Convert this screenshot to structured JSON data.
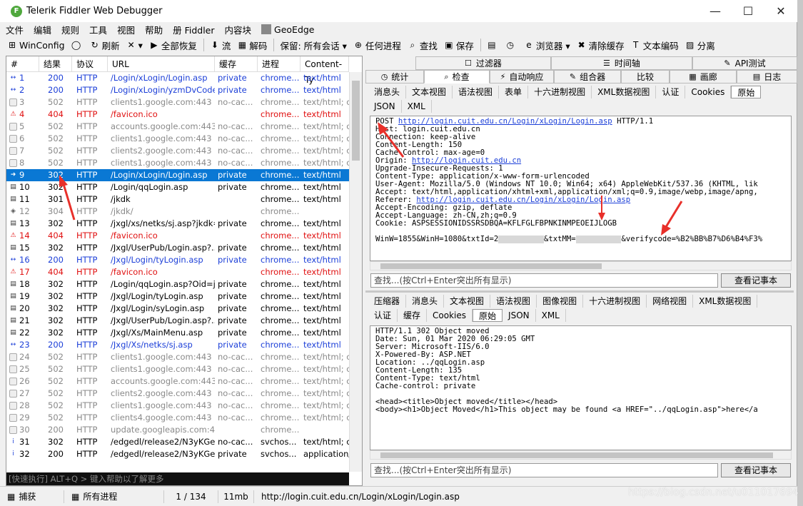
{
  "window": {
    "title": "Telerik Fiddler Web Debugger",
    "app_icon": "F"
  },
  "menu": [
    "文件",
    "编辑",
    "规则",
    "工具",
    "视图",
    "帮助",
    "册 Fiddler",
    "内容块",
    "GeoEdge"
  ],
  "toolbar": [
    {
      "icon": "windows-icon",
      "glyph": "⊞",
      "label": "WinConfig"
    },
    {
      "icon": "comment-icon",
      "glyph": "◯",
      "label": ""
    },
    {
      "icon": "refresh-icon",
      "glyph": "↻",
      "label": "刷新"
    },
    {
      "icon": "remove-icon",
      "glyph": "✕",
      "label": "▾"
    },
    {
      "icon": "play-icon",
      "glyph": "▶",
      "label": "全部恢复"
    },
    {
      "icon": "stream-icon",
      "glyph": "⬇",
      "label": "流"
    },
    {
      "icon": "decode-icon",
      "glyph": "▦",
      "label": "解码"
    },
    {
      "icon": "keep-icon",
      "glyph": "",
      "label": "保留: 所有会话 ▾"
    },
    {
      "icon": "target-icon",
      "glyph": "⊕",
      "label": "任何进程"
    },
    {
      "icon": "find-icon",
      "glyph": "⌕",
      "label": "查找"
    },
    {
      "icon": "save-icon",
      "glyph": "▣",
      "label": "保存"
    },
    {
      "icon": "screenshot-icon",
      "glyph": "▤",
      "label": ""
    },
    {
      "icon": "timer-icon",
      "glyph": "◷",
      "label": ""
    },
    {
      "icon": "browser-icon",
      "glyph": "e",
      "label": "浏览器 ▾"
    },
    {
      "icon": "clear-cache-icon",
      "glyph": "✖",
      "label": "清除缓存"
    },
    {
      "icon": "text-encode-icon",
      "glyph": "T",
      "label": "文本编码"
    },
    {
      "icon": "tearoff-icon",
      "glyph": "▨",
      "label": "分离"
    }
  ],
  "sessions": {
    "columns": [
      "#",
      "结果",
      "协议",
      "URL",
      "缓存",
      "进程",
      "Content-Ty"
    ],
    "rows": [
      {
        "id": "1",
        "result": "200",
        "protocol": "HTTP",
        "url": "/Login/xLogin/Login.asp",
        "cache": "private",
        "process": "chrome...",
        "ctype": "text/html",
        "style": "blue",
        "icon": "↔"
      },
      {
        "id": "2",
        "result": "200",
        "protocol": "HTTP",
        "url": "/Login/xLogin/yzmDvCode...",
        "cache": "private",
        "process": "chrome...",
        "ctype": "text/html",
        "style": "blue",
        "icon": "↔"
      },
      {
        "id": "3",
        "result": "502",
        "protocol": "HTTP",
        "url": "clients1.google.com:443",
        "cache": "no-cac...",
        "process": "chrome...",
        "ctype": "text/html; c",
        "style": "gray",
        "icon": "🔒"
      },
      {
        "id": "4",
        "result": "404",
        "protocol": "HTTP",
        "url": "/favicon.ico",
        "cache": "",
        "process": "chrome...",
        "ctype": "text/html",
        "style": "red",
        "icon": "⚠"
      },
      {
        "id": "5",
        "result": "502",
        "protocol": "HTTP",
        "url": "accounts.google.com:443",
        "cache": "no-cac...",
        "process": "chrome...",
        "ctype": "text/html; c",
        "style": "gray",
        "icon": "🔒"
      },
      {
        "id": "6",
        "result": "502",
        "protocol": "HTTP",
        "url": "clients1.google.com:443",
        "cache": "no-cac...",
        "process": "chrome...",
        "ctype": "text/html; c",
        "style": "gray",
        "icon": "🔒"
      },
      {
        "id": "7",
        "result": "502",
        "protocol": "HTTP",
        "url": "clients2.google.com:443",
        "cache": "no-cac...",
        "process": "chrome...",
        "ctype": "text/html; c",
        "style": "gray",
        "icon": "🔒"
      },
      {
        "id": "8",
        "result": "502",
        "protocol": "HTTP",
        "url": "clients1.google.com:443",
        "cache": "no-cac...",
        "process": "chrome...",
        "ctype": "text/html; c",
        "style": "gray",
        "icon": "🔒"
      },
      {
        "id": "9",
        "result": "302",
        "protocol": "HTTP",
        "url": "/Login/xLogin/Login.asp",
        "cache": "private",
        "process": "chrome...",
        "ctype": "text/html",
        "style": "sel",
        "icon": "➜"
      },
      {
        "id": "10",
        "result": "302",
        "protocol": "HTTP",
        "url": "/Login/qqLogin.asp",
        "cache": "private",
        "process": "chrome...",
        "ctype": "text/html",
        "style": "",
        "icon": "▤"
      },
      {
        "id": "11",
        "result": "301",
        "protocol": "HTTP",
        "url": "/jkdk",
        "cache": "",
        "process": "chrome...",
        "ctype": "text/html",
        "style": "",
        "icon": "▤"
      },
      {
        "id": "12",
        "result": "304",
        "protocol": "HTTP",
        "url": "/jkdk/",
        "cache": "",
        "process": "chrome...",
        "ctype": "",
        "style": "gray",
        "icon": "◈"
      },
      {
        "id": "13",
        "result": "302",
        "protocol": "HTTP",
        "url": "/jxgl/xs/netks/sj.asp?jkdk=Y",
        "cache": "private",
        "process": "chrome...",
        "ctype": "text/html",
        "style": "",
        "icon": "▤"
      },
      {
        "id": "14",
        "result": "404",
        "protocol": "HTTP",
        "url": "/favicon.ico",
        "cache": "",
        "process": "chrome...",
        "ctype": "text/html",
        "style": "red",
        "icon": "⚠"
      },
      {
        "id": "15",
        "result": "302",
        "protocol": "HTTP",
        "url": "/Jxgl/UserPub/Login.asp?...",
        "cache": "private",
        "process": "chrome...",
        "ctype": "text/html",
        "style": "",
        "icon": "▤"
      },
      {
        "id": "16",
        "result": "200",
        "protocol": "HTTP",
        "url": "/Jxgl/Login/tyLogin.asp",
        "cache": "private",
        "process": "chrome...",
        "ctype": "text/html",
        "style": "blue",
        "icon": "↔"
      },
      {
        "id": "17",
        "result": "404",
        "protocol": "HTTP",
        "url": "/favicon.ico",
        "cache": "",
        "process": "chrome...",
        "ctype": "text/html",
        "style": "red",
        "icon": "⚠"
      },
      {
        "id": "18",
        "result": "302",
        "protocol": "HTTP",
        "url": "/Login/qqLogin.asp?Oid=j...",
        "cache": "private",
        "process": "chrome...",
        "ctype": "text/html",
        "style": "",
        "icon": "▤"
      },
      {
        "id": "19",
        "result": "302",
        "protocol": "HTTP",
        "url": "/Jxgl/Login/tyLogin.asp",
        "cache": "private",
        "process": "chrome...",
        "ctype": "text/html",
        "style": "",
        "icon": "▤"
      },
      {
        "id": "20",
        "result": "302",
        "protocol": "HTTP",
        "url": "/Jxgl/Login/syLogin.asp",
        "cache": "private",
        "process": "chrome...",
        "ctype": "text/html",
        "style": "",
        "icon": "▤"
      },
      {
        "id": "21",
        "result": "302",
        "protocol": "HTTP",
        "url": "/Jxgl/UserPub/Login.asp?...",
        "cache": "private",
        "process": "chrome...",
        "ctype": "text/html",
        "style": "",
        "icon": "▤"
      },
      {
        "id": "22",
        "result": "302",
        "protocol": "HTTP",
        "url": "/Jxgl/Xs/MainMenu.asp",
        "cache": "private",
        "process": "chrome...",
        "ctype": "text/html",
        "style": "",
        "icon": "▤"
      },
      {
        "id": "23",
        "result": "200",
        "protocol": "HTTP",
        "url": "/Jxgl/Xs/netks/sj.asp",
        "cache": "private",
        "process": "chrome...",
        "ctype": "text/html",
        "style": "blue",
        "icon": "↔"
      },
      {
        "id": "24",
        "result": "502",
        "protocol": "HTTP",
        "url": "clients1.google.com:443",
        "cache": "no-cac...",
        "process": "chrome...",
        "ctype": "text/html; c",
        "style": "gray",
        "icon": "🔒"
      },
      {
        "id": "25",
        "result": "502",
        "protocol": "HTTP",
        "url": "clients1.google.com:443",
        "cache": "no-cac...",
        "process": "chrome...",
        "ctype": "text/html; c",
        "style": "gray",
        "icon": "🔒"
      },
      {
        "id": "26",
        "result": "502",
        "protocol": "HTTP",
        "url": "accounts.google.com:443",
        "cache": "no-cac...",
        "process": "chrome...",
        "ctype": "text/html; c",
        "style": "gray",
        "icon": "🔒"
      },
      {
        "id": "27",
        "result": "502",
        "protocol": "HTTP",
        "url": "clients2.google.com:443",
        "cache": "no-cac...",
        "process": "chrome...",
        "ctype": "text/html; c",
        "style": "gray",
        "icon": "🔒"
      },
      {
        "id": "28",
        "result": "502",
        "protocol": "HTTP",
        "url": "clients1.google.com:443",
        "cache": "no-cac...",
        "process": "chrome...",
        "ctype": "text/html; c",
        "style": "gray",
        "icon": "🔒"
      },
      {
        "id": "29",
        "result": "502",
        "protocol": "HTTP",
        "url": "clients4.google.com:443",
        "cache": "no-cac...",
        "process": "chrome...",
        "ctype": "text/html; c",
        "style": "gray",
        "icon": "🔒"
      },
      {
        "id": "30",
        "result": "200",
        "protocol": "HTTP",
        "url": "update.googleapis.com:443",
        "cache": "",
        "process": "chrome...",
        "ctype": "",
        "style": "gray",
        "icon": "🔒"
      },
      {
        "id": "31",
        "result": "302",
        "protocol": "HTTP",
        "url": "/edgedl/release2/N3yKGe...",
        "cache": "no-cac...",
        "process": "svchos...",
        "ctype": "text/html; c",
        "style": "",
        "icon": "i"
      },
      {
        "id": "32",
        "result": "200",
        "protocol": "HTTP",
        "url": "/edgedl/release2/N3yKGe...",
        "cache": "private",
        "process": "svchos...",
        "ctype": "application/",
        "style": "",
        "icon": "i"
      }
    ]
  },
  "quickexec": "[快速执行] ALT+Q > 键入帮助以了解更多",
  "status": {
    "capture": "捕获",
    "process": "所有进程",
    "count": "1 / 134",
    "size": "11mb",
    "url": "http://login.cuit.edu.cn/Login/xLogin/Login.asp"
  },
  "tabs": {
    "top1": [
      "过滤器",
      "时间轴",
      "API测试"
    ],
    "top2": [
      "统计",
      "检查",
      "自动响应",
      "组合器",
      "比较",
      "画廊",
      "日志"
    ],
    "req_sub1": [
      "消息头",
      "文本视图",
      "语法视图",
      "表单",
      "十六进制视图",
      "XML数据视图",
      "认证",
      "Cookies",
      "原始"
    ],
    "req_sub2": [
      "JSON",
      "XML"
    ],
    "resp_sub1": [
      "压缩器",
      "消息头",
      "文本视图",
      "语法视图",
      "图像视图",
      "十六进制视图",
      "网络视图",
      "XML数据视图"
    ],
    "resp_sub2": [
      "认证",
      "缓存",
      "Cookies",
      "原始",
      "JSON",
      "XML"
    ]
  },
  "request": {
    "line_method": "POST",
    "line_url": "http://login.cuit.edu.cn/Login/xLogin/Login.asp",
    "line_proto": "HTTP/1.1",
    "host": "Host: login.cuit.edu.cn",
    "conn": "Connection: keep-alive",
    "clen": "Content-Length: 150",
    "cache": "Cache-Control: max-age=0",
    "origin_label": "Origin: ",
    "origin_url": "http://login.cuit.edu.cn",
    "upgrade": "Upgrade-Insecure-Requests: 1",
    "ctype": "Content-Type: application/x-www-form-urlencoded",
    "ua": "User-Agent: Mozilla/5.0 (Windows NT 10.0; Win64; x64) AppleWebKit/537.36 (KHTML, lik",
    "accept": "Accept: text/html,application/xhtml+xml,application/xml;q=0.9,image/webp,image/apng,",
    "referer_label": "Referer: ",
    "referer_url": "http://login.cuit.edu.cn/Login/xLogin/Login.asp",
    "aenc": "Accept-Encoding: gzip, deflate",
    "alang": "Accept-Language: zh-CN,zh;q=0.9",
    "cookie": "Cookie: ASPSESSIONIDSSRSDBQA=KFLFGLFBPNKINMPEOEIJLOGB",
    "body_a": "WinW=1855&WinH=1080&txtId=2",
    "body_b": "&txtMM=",
    "body_c": "&verifycode=%B2%BB%B7%D6%B4%F3%"
  },
  "response": {
    "l1": "HTTP/1.1 302 Object moved",
    "l2": "Date: Sun, 01 Mar 2020 06:29:05 GMT",
    "l3": "Server: Microsoft-IIS/6.0",
    "l4": "X-Powered-By: ASP.NET",
    "l5": "Location: ../qqLogin.asp",
    "l6": "Content-Length: 135",
    "l7": "Content-Type: text/html",
    "l8": "Cache-control: private",
    "l9": "<head><title>Object moved</title></head>",
    "l10": "<body><h1>Object Moved</h1>This object may be found <a HREF=\"../qqLogin.asp\">here</a"
  },
  "find": {
    "placeholder": "查找...(按Ctrl+Enter突出所有显示)",
    "button": "查看记事本"
  },
  "watermark": "https://blog.csdn.net/u011017694"
}
